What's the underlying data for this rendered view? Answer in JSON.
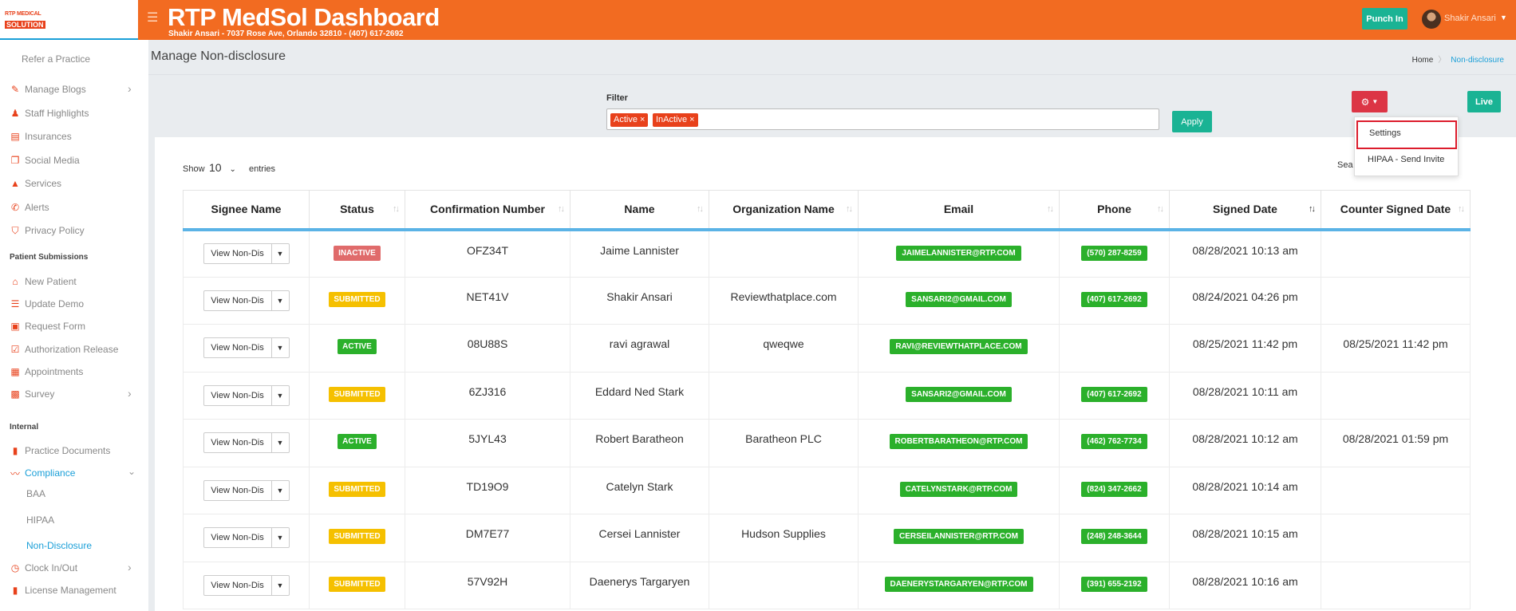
{
  "header": {
    "logo_top": "RTP MEDICAL",
    "logo_bottom": "SOLUTION",
    "title": "RTP MedSol Dashboard",
    "subtitle": "Shakir Ansari - 7037 Rose Ave, Orlando 32810 - (407) 617-2692",
    "punch_in": "Punch In",
    "user_name": "Shakir Ansari"
  },
  "sidebar": {
    "refer": "Refer a Practice",
    "items_top": [
      {
        "label": "Manage Blogs",
        "icon": "blog-icon",
        "glyph": "✎",
        "chevron": true
      },
      {
        "label": "Staff Highlights",
        "icon": "staff-icon",
        "glyph": "♟",
        "chevron": false
      },
      {
        "label": "Insurances",
        "icon": "insurance-icon",
        "glyph": "▤",
        "chevron": false
      },
      {
        "label": "Social Media",
        "icon": "social-icon",
        "glyph": "❐",
        "chevron": false
      },
      {
        "label": "Services",
        "icon": "services-icon",
        "glyph": "▲",
        "chevron": false
      },
      {
        "label": "Alerts",
        "icon": "phone-icon",
        "glyph": "✆",
        "chevron": false
      },
      {
        "label": "Privacy Policy",
        "icon": "shield-icon",
        "glyph": "⛉",
        "chevron": false
      }
    ],
    "section_patient": "Patient Submissions",
    "items_patient": [
      {
        "label": "New Patient",
        "icon": "home-icon",
        "glyph": "⌂",
        "chevron": false
      },
      {
        "label": "Update Demo",
        "icon": "list-icon",
        "glyph": "☰",
        "chevron": false
      },
      {
        "label": "Request Form",
        "icon": "form-icon",
        "glyph": "▣",
        "chevron": false
      },
      {
        "label": "Authorization Release",
        "icon": "check-icon",
        "glyph": "☑",
        "chevron": false
      },
      {
        "label": "Appointments",
        "icon": "calendar-icon",
        "glyph": "▦",
        "chevron": false
      },
      {
        "label": "Survey",
        "icon": "survey-icon",
        "glyph": "▩",
        "chevron": true
      }
    ],
    "section_internal": "Internal",
    "practice_documents": "Practice Documents",
    "compliance": "Compliance",
    "compliance_sub": [
      "BAA",
      "HIPAA",
      "Non-Disclosure"
    ],
    "clock": "Clock In/Out",
    "license": "License Management"
  },
  "page": {
    "title": "Manage Non-disclosure",
    "breadcrumb_home": "Home",
    "breadcrumb_current": "Non-disclosure"
  },
  "filter": {
    "label": "Filter",
    "chips": [
      "Active ×",
      "InActive ×"
    ],
    "apply": "Apply"
  },
  "live": "Live",
  "gear_menu": {
    "settings": "Settings",
    "hipaa": "HIPAA - Send Invite"
  },
  "table_controls": {
    "show": "Show",
    "entries_value": "10",
    "entries": "entries",
    "search": "Sea"
  },
  "table": {
    "headers": [
      "Signee Name",
      "Status",
      "Confirmation Number",
      "Name",
      "Organization Name",
      "Email",
      "Phone",
      "Signed Date",
      "Counter Signed Date"
    ],
    "view_label": "View Non-Dis",
    "rows": [
      {
        "status": "INACTIVE",
        "status_class": "b-inactive",
        "conf": "OFZ34T",
        "name": "Jaime Lannister",
        "org": "",
        "email": "JAIMELANNISTER@RTP.COM",
        "phone": "(570) 287-8259",
        "signed": "08/28/2021 10:13 am",
        "counter": ""
      },
      {
        "status": "SUBMITTED",
        "status_class": "b-submitted",
        "conf": "NET41V",
        "name": "Shakir Ansari",
        "org": "Reviewthatplace.com",
        "email": "SANSARI2@GMAIL.COM",
        "phone": "(407) 617-2692",
        "signed": "08/24/2021 04:26 pm",
        "counter": ""
      },
      {
        "status": "ACTIVE",
        "status_class": "b-active",
        "conf": "08U88S",
        "name": "ravi agrawal",
        "org": "qweqwe",
        "email": "RAVI@REVIEWTHATPLACE.COM",
        "phone": "",
        "signed": "08/25/2021 11:42 pm",
        "counter": "08/25/2021 11:42 pm"
      },
      {
        "status": "SUBMITTED",
        "status_class": "b-submitted",
        "conf": "6ZJ316",
        "name": "Eddard Ned Stark",
        "org": "",
        "email": "SANSARI2@GMAIL.COM",
        "phone": "(407) 617-2692",
        "signed": "08/28/2021 10:11 am",
        "counter": ""
      },
      {
        "status": "ACTIVE",
        "status_class": "b-active",
        "conf": "5JYL43",
        "name": "Robert Baratheon",
        "org": "Baratheon PLC",
        "email": "ROBERTBARATHEON@RTP.COM",
        "phone": "(462) 762-7734",
        "signed": "08/28/2021 10:12 am",
        "counter": "08/28/2021 01:59 pm"
      },
      {
        "status": "SUBMITTED",
        "status_class": "b-submitted",
        "conf": "TD19O9",
        "name": "Catelyn Stark",
        "org": "",
        "email": "CATELYNSTARK@RTP.COM",
        "phone": "(824) 347-2662",
        "signed": "08/28/2021 10:14 am",
        "counter": ""
      },
      {
        "status": "SUBMITTED",
        "status_class": "b-submitted",
        "conf": "DM7E77",
        "name": "Cersei Lannister",
        "org": "Hudson Supplies",
        "email": "CERSEILANNISTER@RTP.COM",
        "phone": "(248) 248-3644",
        "signed": "08/28/2021 10:15 am",
        "counter": ""
      },
      {
        "status": "SUBMITTED",
        "status_class": "b-submitted",
        "conf": "57V92H",
        "name": "Daenerys Targaryen",
        "org": "",
        "email": "DAENERYSTARGARYEN@RTP.COM",
        "phone": "(391) 655-2192",
        "signed": "08/28/2021 10:16 am",
        "counter": ""
      }
    ]
  }
}
